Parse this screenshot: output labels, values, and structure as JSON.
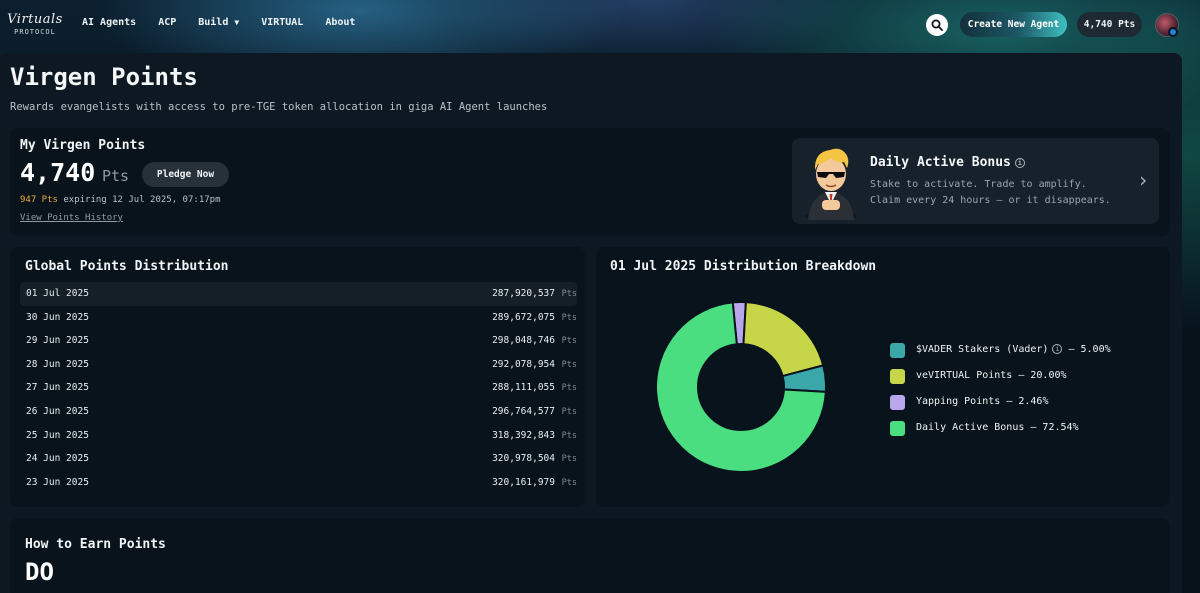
{
  "nav": {
    "logo_script": "Virtuals",
    "logo_sub": "PROTOCOL",
    "links": [
      {
        "label": "AI Agents"
      },
      {
        "label": "ACP"
      },
      {
        "label": "Build",
        "has_caret": true
      },
      {
        "label": "VIRTUAL"
      },
      {
        "label": "About"
      }
    ],
    "search_icon": "search-icon",
    "create_agent_label": "Create New Agent",
    "points_pill": "4,740 Pts"
  },
  "page": {
    "title": "Virgen Points",
    "subtitle": "Rewards evangelists with access to pre-TGE token allocation in giga AI Agent launches"
  },
  "my_points": {
    "title": "My Virgen Points",
    "value": "4,740",
    "unit": "Pts",
    "pledge_label": "Pledge Now",
    "expiring_amount": "947 Pts",
    "expiring_text": " expiring 12 Jul 2025, 07:17pm",
    "history_link": "View Points History"
  },
  "bonus": {
    "title": "Daily Active Bonus",
    "info_icon": "info-icon",
    "line1": "Stake to activate. Trade to amplify.",
    "line2": "Claim every 24 hours — or it disappears.",
    "chevron_icon": "chevron-right-icon"
  },
  "global_distribution": {
    "title": "Global Points Distribution",
    "unit": "Pts",
    "rows": [
      {
        "date": "01 Jul 2025",
        "value": "287,920,537"
      },
      {
        "date": "30 Jun 2025",
        "value": "289,672,075"
      },
      {
        "date": "29 Jun 2025",
        "value": "298,048,746"
      },
      {
        "date": "28 Jun 2025",
        "value": "292,078,954"
      },
      {
        "date": "27 Jun 2025",
        "value": "288,111,055"
      },
      {
        "date": "26 Jun 2025",
        "value": "296,764,577"
      },
      {
        "date": "25 Jun 2025",
        "value": "318,392,843"
      },
      {
        "date": "24 Jun 2025",
        "value": "320,978,504"
      },
      {
        "date": "23 Jun 2025",
        "value": "320,161,979"
      }
    ]
  },
  "breakdown": {
    "title": "01 Jul 2025 Distribution Breakdown",
    "legend": [
      {
        "label": "$VADER Stakers (Vader)",
        "pct_text": " – 5.00%",
        "pct": 5.0,
        "color": "#3aa7a8",
        "info": true
      },
      {
        "label": "veVIRTUAL Points",
        "pct_text": " – 20.00%",
        "pct": 20.0,
        "color": "#c7d548",
        "info": false
      },
      {
        "label": "Yapping Points",
        "pct_text": " – 2.46%",
        "pct": 2.46,
        "color": "#b9a6ec",
        "info": false
      },
      {
        "label": "Daily Active Bonus",
        "pct_text": " – 72.54%",
        "pct": 72.54,
        "color": "#4ade80",
        "info": false
      }
    ]
  },
  "earn": {
    "title": "How to Earn Points",
    "subheading": "DO"
  }
}
